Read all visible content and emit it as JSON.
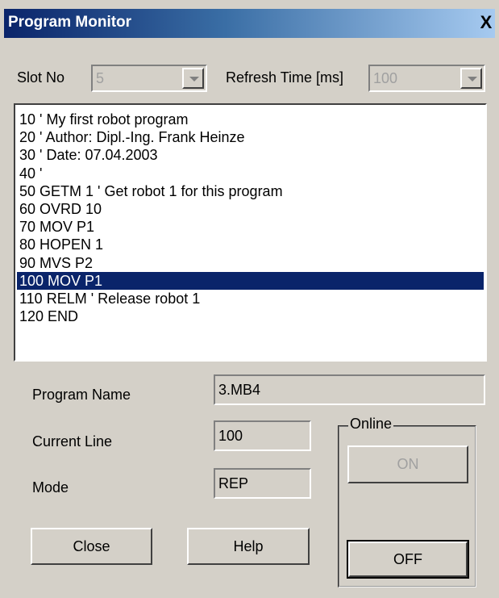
{
  "window": {
    "title": "Program Monitor",
    "close_label": "X"
  },
  "slot": {
    "label": "Slot No",
    "value": "5"
  },
  "refresh": {
    "label": "Refresh Time [ms]",
    "value": "100"
  },
  "program_lines": [
    "10 ' My first robot program",
    "20 ' Author: Dipl.-Ing. Frank Heinze",
    "30 ' Date: 07.04.2003",
    "40 '",
    "50 GETM 1 ' Get robot 1 for this program",
    "60 OVRD 10",
    "70 MOV P1",
    "80 HOPEN 1",
    "90 MVS P2",
    "100 MOV P1",
    "110 RELM ' Release robot 1",
    "120 END"
  ],
  "selected_line_index": 9,
  "info": {
    "program_name_label": "Program Name",
    "program_name_value": "3.MB4",
    "current_line_label": "Current Line",
    "current_line_value": "100",
    "mode_label": "Mode",
    "mode_value": "REP"
  },
  "online": {
    "label": "Online",
    "on_label": "ON",
    "off_label": "OFF"
  },
  "buttons": {
    "close_label": "Close",
    "help_label": "Help"
  },
  "colors": {
    "selection": "#0a246a",
    "face": "#d4d0c8"
  }
}
